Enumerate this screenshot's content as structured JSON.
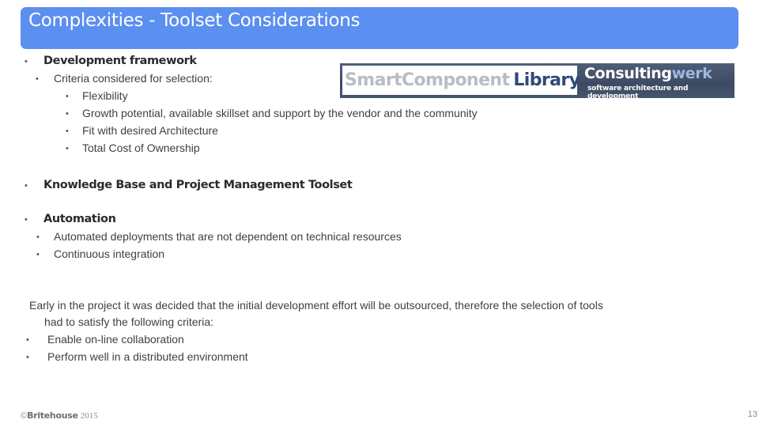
{
  "slide": {
    "title": "Complexities - Toolset Considerations",
    "accent_color": "#5b8ff0",
    "bullet_glyph": "•",
    "sections": [
      {
        "heading": "Development framework",
        "sub_heading": "Criteria considered for selection:",
        "criteria": [
          "Flexibility",
          "Growth potential, available skillset and support by the vendor and the community",
          "Fit with desired Architecture",
          "Total Cost of Ownership"
        ]
      },
      {
        "heading": "Knowledge Base and Project Management Toolset"
      },
      {
        "heading": "Automation",
        "items": [
          "Automated deployments that are not dependent on technical resources",
          "Continuous integration"
        ]
      }
    ],
    "paragraph": {
      "line1": "Early in the project it was decided that the initial development effort will be outsourced, therefore the selection of tools",
      "line2": "had to satisfy the following criteria:",
      "items": [
        "Enable on-line collaboration",
        "Perform well in a distributed environment"
      ]
    }
  },
  "logo": {
    "left_part1": "SmartComponent",
    "left_part2": "Library",
    "right_part1": "Consulting",
    "right_part2": "werk",
    "tagline": "software architecture and development"
  },
  "footer": {
    "copyright_symbol": "©",
    "brand": "Britehouse",
    "year": "2015",
    "page_number": "13"
  }
}
